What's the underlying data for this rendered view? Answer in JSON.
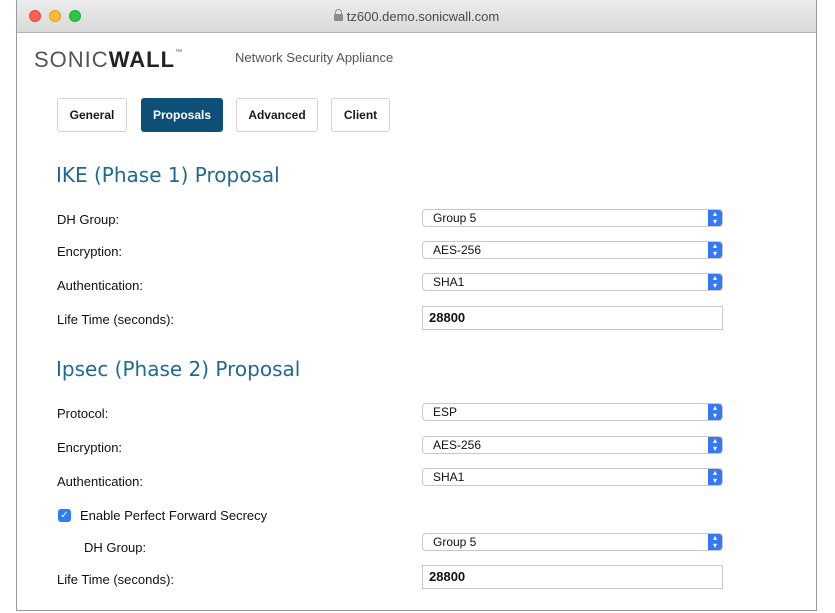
{
  "browser": {
    "url": "tz600.demo.sonicwall.com"
  },
  "brand": {
    "logo_light": "SONIC",
    "logo_bold": "WALL",
    "tm": "™",
    "tagline": "Network Security Appliance"
  },
  "tabs": [
    {
      "label": "General"
    },
    {
      "label": "Proposals",
      "active": true
    },
    {
      "label": "Advanced"
    },
    {
      "label": "Client"
    }
  ],
  "ike": {
    "title": "IKE (Phase 1) Proposal",
    "dh_group": {
      "label": "DH Group:",
      "value": "Group 5"
    },
    "encryption": {
      "label": "Encryption:",
      "value": "AES-256"
    },
    "authentication": {
      "label": "Authentication:",
      "value": "SHA1"
    },
    "lifetime": {
      "label": "Life Time (seconds):",
      "value": "28800"
    }
  },
  "ipsec": {
    "title": "Ipsec (Phase 2) Proposal",
    "protocol": {
      "label": "Protocol:",
      "value": "ESP"
    },
    "encryption": {
      "label": "Encryption:",
      "value": "AES-256"
    },
    "authentication": {
      "label": "Authentication:",
      "value": "SHA1"
    },
    "pfs": {
      "label": "Enable Perfect Forward Secrecy",
      "checked": true
    },
    "dh_group": {
      "label": "DH Group:",
      "value": "Group 5"
    },
    "lifetime": {
      "label": "Life Time (seconds):",
      "value": "28800"
    }
  },
  "colors": {
    "accent": "#0e4f78",
    "title": "#1f6a91",
    "select_arrow": "#3478f6"
  }
}
